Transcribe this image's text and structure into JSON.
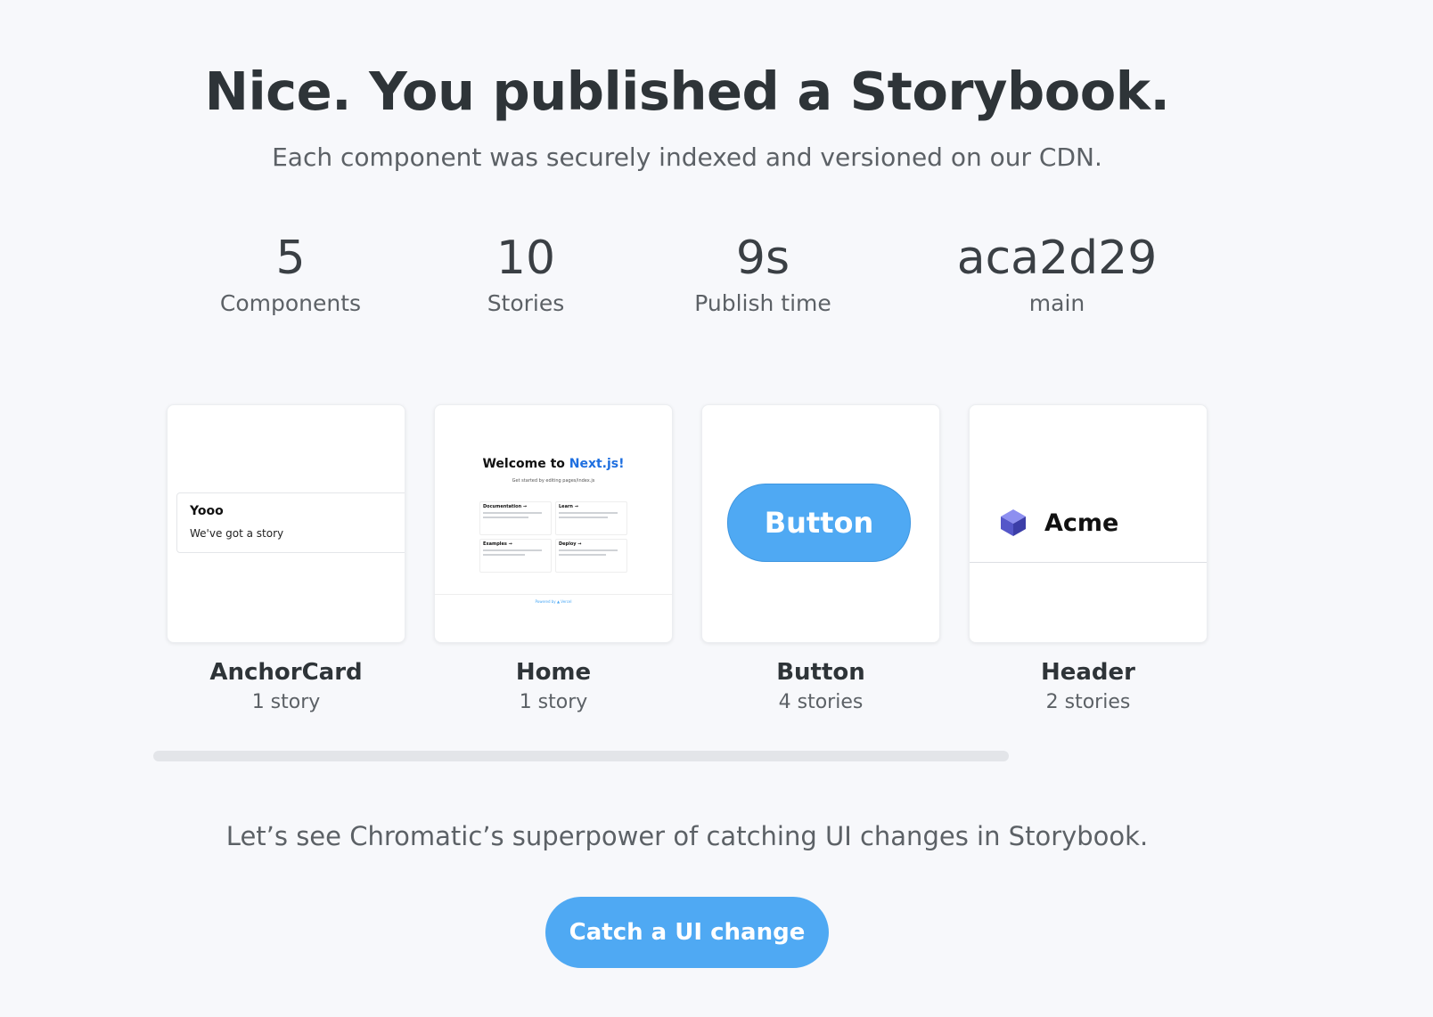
{
  "title": "Nice. You published a Storybook.",
  "subtitle": "Each component was securely indexed and versioned on our CDN.",
  "stats": [
    {
      "value": "5",
      "label": "Components"
    },
    {
      "value": "10",
      "label": "Stories"
    },
    {
      "value": "9s",
      "label": "Publish time"
    },
    {
      "value": "aca2d29",
      "label": "main"
    }
  ],
  "components": [
    {
      "name": "AnchorCard",
      "count": "1 story",
      "preview": {
        "title": "Yooo",
        "text": "We've got a story"
      }
    },
    {
      "name": "Home",
      "count": "1 story",
      "preview": {
        "heading_prefix": "Welcome to ",
        "heading_accent": "Next.js!",
        "sub": "Get started by editing pages/index.js",
        "cells": [
          "Documentation →",
          "Learn →",
          "Examples →",
          "Deploy →"
        ],
        "footer": "Powered by ▲ Vercel"
      }
    },
    {
      "name": "Button",
      "count": "4 stories",
      "preview": {
        "label": "Button"
      }
    },
    {
      "name": "Header",
      "count": "2 stories",
      "preview": {
        "brand": "Acme"
      }
    }
  ],
  "cta": {
    "text": "Let’s see Chromatic’s superpower of catching UI changes in Storybook.",
    "button": "Catch a UI change"
  },
  "colors": {
    "background": "#f7f8fb",
    "accent": "#4fa9f3",
    "heading": "#2e3438",
    "muted": "#5c6166"
  }
}
